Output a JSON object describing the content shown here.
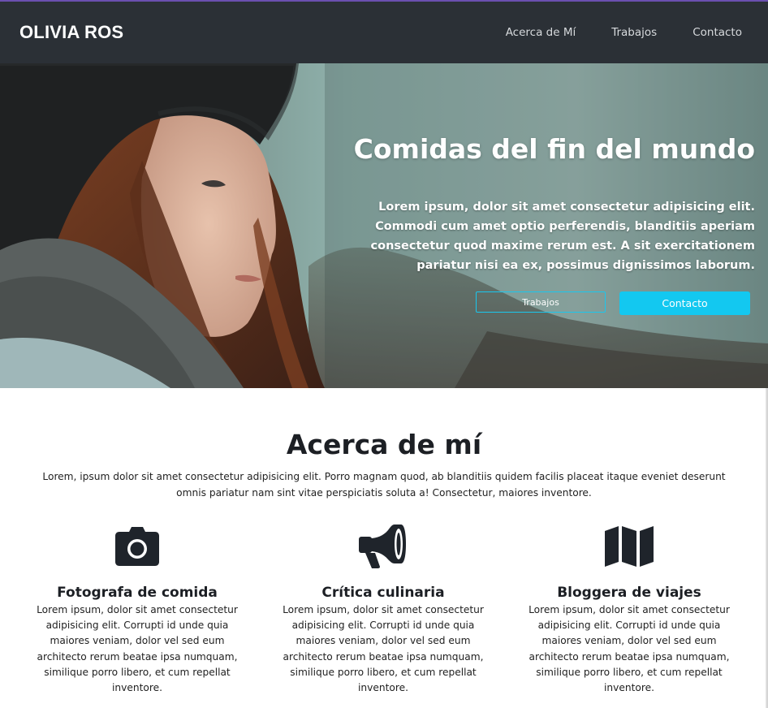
{
  "navbar": {
    "brand": "OLIVIA ROS",
    "links": [
      "Acerca de Mí",
      "Trabajos",
      "Contacto"
    ]
  },
  "hero": {
    "title": "Comidas del fin del mundo",
    "text": "Lorem ipsum, dolor sit amet consectetur adipisicing elit. Commodi cum amet optio perferendis, blanditiis aperiam consectetur quod maxime rerum est. A sit exercitationem pariatur nisi ea ex, possimus dignissimos laborum.",
    "button_outline": "Trabajos",
    "button_solid": "Contacto"
  },
  "about": {
    "title": "Acerca de mí",
    "text": "Lorem, ipsum dolor sit amet consectetur adipisicing elit. Porro magnam quod, ab blanditiis quidem facilis placeat itaque eveniet deserunt omnis pariatur nam sint vitae perspiciatis soluta a! Consectetur, maiores inventore.",
    "features": [
      {
        "icon": "camera-icon",
        "title": "Fotografa de comida",
        "text": "Lorem ipsum, dolor sit amet consectetur adipisicing elit. Corrupti id unde quia maiores veniam, dolor vel sed eum architecto rerum beatae ipsa numquam, similique porro libero, et cum repellat inventore."
      },
      {
        "icon": "megaphone-icon",
        "title": "Crítica culinaria",
        "text": "Lorem ipsum, dolor sit amet consectetur adipisicing elit. Corrupti id unde quia maiores veniam, dolor vel sed eum architecto rerum beatae ipsa numquam, similique porro libero, et cum repellat inventore."
      },
      {
        "icon": "map-icon",
        "title": "Bloggera de viajes",
        "text": "Lorem ipsum, dolor sit amet consectetur adipisicing elit. Corrupti id unde quia maiores veniam, dolor vel sed eum architecto rerum beatae ipsa numquam, similique porro libero, et cum repellat inventore."
      }
    ]
  },
  "colors": {
    "navbar_bg": "#2b3036",
    "accent": "#13c8f0",
    "text_dark": "#1c1f24"
  }
}
